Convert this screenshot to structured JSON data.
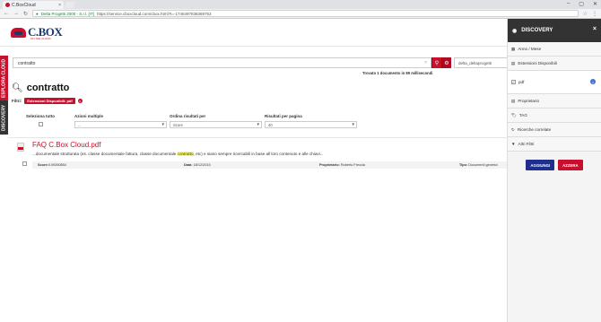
{
  "browser": {
    "tab_title": "C.BoxCloud",
    "tab_close": "×",
    "window_controls": [
      "–",
      "▢",
      "✕"
    ],
    "nav_icons": [
      "←",
      "→",
      "↻"
    ],
    "secure_label": "Delta Progetti 2000 - S.r.l. [IT]",
    "url": "https://service.cboxcloud.com/cbox.html?t=-1746497838369753",
    "star_icon": "☆",
    "menu_icon": "⋮"
  },
  "app": {
    "logo_text": "C.BOX",
    "logo_tag": "ON THE CLOUD"
  },
  "vertical_tabs": [
    "ESPLORA CLOUD",
    "DISCOVERY"
  ],
  "search": {
    "query": "contratto",
    "clear": "×",
    "search_icon": "⚲",
    "settings_icon": "⚙",
    "user_field": "delta_deltaprogetti",
    "found_text": "Trovato 1 documento in 89 millisecondi"
  },
  "query_title": "contratto",
  "filters": {
    "label": "Filtri:",
    "chips": [
      "Estensioni Disponibili: pdf"
    ],
    "remove": "×"
  },
  "controls": {
    "select_all_label": "Seleziona tutto",
    "multi_label": "Azioni multiple",
    "multi_value": "...",
    "sort_label": "Ordina risultati per",
    "sort_value": "Score",
    "per_page_label": "Risultati per pagina",
    "per_page_value": "40"
  },
  "results": [
    {
      "title": "FAQ C.Box Cloud.pdf",
      "snippet_pre": "...documentale strutturata (es. classe documentale fattura, classe documentale ",
      "snippet_hl": "contratto",
      "snippet_post": ", etc) e siano sempre ricercabili in base all loro contenuto e alle chiavi...",
      "score_label": "Score:",
      "score": "0.09260854",
      "date_label": "Data:",
      "date": "18/12/2015",
      "owner_label": "Proprietario:",
      "owner": "Roberto Freccia",
      "type_label": "Tipo:",
      "type": "Documenti generici"
    }
  ],
  "panel": {
    "title": "DISCOVERY",
    "close": "×",
    "sections": [
      {
        "label": "Anno / Mese",
        "icon": "▦"
      },
      {
        "label": "Estensioni Disponibili",
        "icon": "▤"
      },
      {
        "label": "Proprietario",
        "icon": "▤"
      },
      {
        "label": "TAG",
        "icon": "🏷"
      },
      {
        "label": "Ricerche correlate",
        "icon": "↻"
      },
      {
        "label": "Altri Filtri",
        "icon": "▼"
      }
    ],
    "ext_option": "pdf",
    "ext_count": "1",
    "apply_btn": "AGGIUNGI",
    "reset_btn": "AZZERA"
  }
}
